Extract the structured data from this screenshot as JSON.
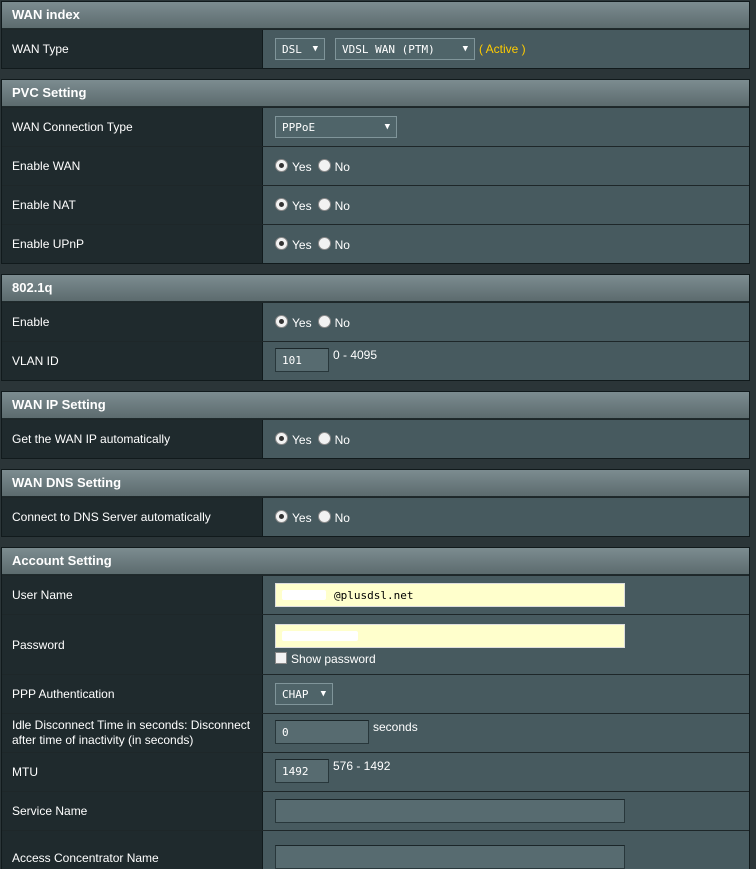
{
  "wan_index": {
    "title": "WAN index",
    "wan_type_label": "WAN Type",
    "wan_type_value": "DSL",
    "mode_value": "VDSL WAN (PTM)",
    "status": "( Active )"
  },
  "pvc": {
    "title": "PVC Setting",
    "conn_type_label": "WAN Connection Type",
    "conn_type_value": "PPPoE",
    "enable_wan_label": "Enable WAN",
    "enable_nat_label": "Enable NAT",
    "enable_upnp_label": "Enable UPnP"
  },
  "vlan": {
    "title": "802.1q",
    "enable_label": "Enable",
    "vlan_id_label": "VLAN ID",
    "vlan_id_value": "101",
    "vlan_range": "0 - 4095"
  },
  "wan_ip": {
    "title": "WAN IP Setting",
    "auto_label": "Get the WAN IP automatically"
  },
  "wan_dns": {
    "title": "WAN DNS Setting",
    "auto_label": "Connect to DNS Server automatically"
  },
  "account": {
    "title": "Account Setting",
    "username_label": "User Name",
    "username_value": "@plusdsl.net",
    "password_label": "Password",
    "show_password_label": "Show password",
    "ppp_auth_label": "PPP Authentication",
    "ppp_auth_value": "CHAP",
    "idle_label": "Idle Disconnect Time in seconds: Disconnect after time of inactivity (in seconds)",
    "idle_value": "0",
    "idle_unit": "seconds",
    "mtu_label": "MTU",
    "mtu_value": "1492",
    "mtu_range": "576 - 1492",
    "service_label": "Service Name",
    "service_value": "",
    "ac_label": "Access Concentrator Name",
    "ac_value": ""
  },
  "radio": {
    "yes": "Yes",
    "no": "No"
  }
}
